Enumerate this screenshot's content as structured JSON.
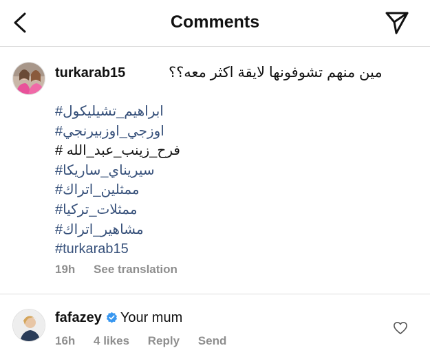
{
  "header": {
    "title": "Comments"
  },
  "post": {
    "username": "turkarab15",
    "caption": "مين منهم تشوفونها لايقة اكثر معه؟؟",
    "hashtags": [
      {
        "text": "#ابراهيم_تشيليكول",
        "linked": true
      },
      {
        "text": "#اوزجي_اوزبيرنجي",
        "linked": true
      },
      {
        "text": "# فرح_زينب_عبد_الله",
        "linked": false
      },
      {
        "text": "#سيريناي_ساريكا",
        "linked": true
      },
      {
        "text": "#ممثلين_اتراك",
        "linked": true
      },
      {
        "text": "#ممثلات_تركيا",
        "linked": true
      },
      {
        "text": "#مشاهير_اتراك",
        "linked": true
      },
      {
        "text": "#turkarab15",
        "linked": true
      }
    ],
    "time": "19h",
    "see_translation": "See translation"
  },
  "comment": {
    "username": "fafazey",
    "verified": true,
    "text": "Your mum",
    "time": "16h",
    "likes": "4 likes",
    "reply": "Reply",
    "send": "Send"
  },
  "icons": {
    "back": "chevron-left-icon",
    "send": "paper-plane-icon",
    "like": "heart-outline-icon",
    "verified": "verified-badge-icon"
  },
  "colors": {
    "hashtag": "#36507a",
    "meta": "#8e8e8e",
    "verified": "#3897f0"
  }
}
